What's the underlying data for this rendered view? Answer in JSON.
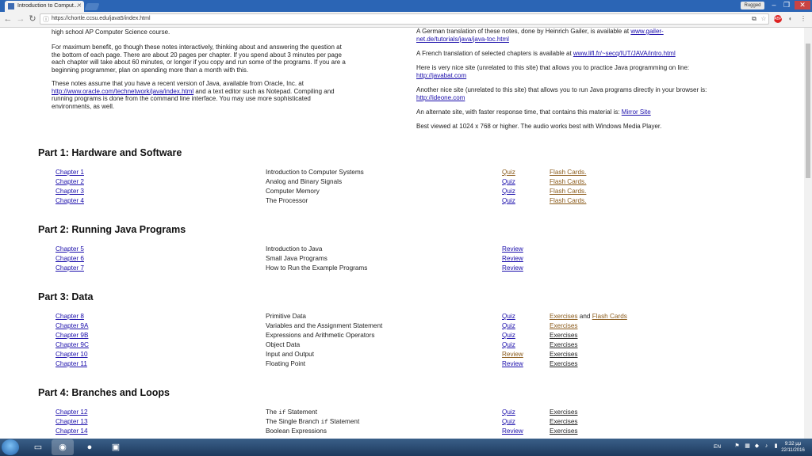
{
  "browser": {
    "tab_title": "Introduction to Comput...",
    "user_label": "Rugged",
    "url": "https://chortle.ccsu.edu/java5/index.html"
  },
  "intro_left": {
    "p0": "high school AP Computer Science course.",
    "p1": "For maximum benefit, go though these notes interactively, thinking about and answering the question at the bottom of each page. There are about 20 pages per chapter. If you spend about 3 minutes per page each chapter will take about 60 minutes, or longer if you copy and run some of the programs. If you are a beginning programmer, plan on spending more than a month with this.",
    "p2_a": "These notes assume that you have a recent version of Java, available from Oracle, Inc. at ",
    "p2_link": "http://www.oracle.com/technetwork/java/index.html",
    "p2_b": " and a text editor such as Notepad. Compiling and running programs is done from the command line interface. You may use more sophisticated environments, as well."
  },
  "intro_right": {
    "german_a": "A German translation of these notes, done by Heinrich Gailer, is available at ",
    "german_link": "www.gailer-net.de/tutorials/java/java-toc.html",
    "french_a": "A French translation of selected chapters is available at ",
    "french_link": "www.lifl.fr/~secq/IUT/JAVA/intro.html",
    "javabat_a": "Here is very nice site (unrelated to this site) that allows you to practice Java programming on line: ",
    "javabat_link": "http://javabat.com",
    "ideone_a": "Another nice site (unrelated to this site) that allows you to run Java programs directly in your browser is: ",
    "ideone_link": "http://ideone.com",
    "mirror_a": "An alternate site, with faster response time, that contains this material is: ",
    "mirror_link": "Mirror Site",
    "best_viewed": "Best viewed at 1024 x 768 or higher. The audio works best with Windows Media Player."
  },
  "parts": [
    {
      "title": "Part 1: Hardware and Software",
      "rows": [
        {
          "chapter": "Chapter 1",
          "topic": "Introduction to Computer Systems",
          "c3": "Quiz",
          "c4": "Flash Cards."
        },
        {
          "chapter": "Chapter 2",
          "topic": "Analog and Binary Signals",
          "c3": "Quiz",
          "c4": "Flash Cards."
        },
        {
          "chapter": "Chapter 3",
          "topic": "Computer Memory",
          "c3": "Quiz",
          "c4": "Flash Cards."
        },
        {
          "chapter": "Chapter 4",
          "topic": "The Processor",
          "c3": "Quiz",
          "c4": "Flash Cards."
        }
      ]
    },
    {
      "title": "Part 2: Running Java Programs",
      "rows": [
        {
          "chapter": "Chapter 5",
          "topic": "Introduction to Java",
          "c3": "Review"
        },
        {
          "chapter": "Chapter 6",
          "topic": "Small Java Programs",
          "c3": "Review"
        },
        {
          "chapter": "Chapter 7",
          "topic": "How to Run the Example Programs",
          "c3": "Review"
        }
      ]
    },
    {
      "title": "Part 3: Data",
      "rows": [
        {
          "chapter": "Chapter 8",
          "topic": "Primitive Data",
          "c3": "Quiz",
          "c4": "Exercises",
          "c4_and": " and ",
          "c4_extra": "Flash Cards"
        },
        {
          "chapter": "Chapter 9A",
          "topic": "Variables and the Assignment Statement",
          "c3": "Quiz",
          "c4": "Exercises"
        },
        {
          "chapter": "Chapter 9B",
          "topic": "Expressions and Arithmetic Operators",
          "c3": "Quiz",
          "c4": "Exercises"
        },
        {
          "chapter": "Chapter 9C",
          "topic": "Object Data",
          "c3": "Quiz",
          "c4": "Exercises"
        },
        {
          "chapter": "Chapter 10",
          "topic": "Input and Output",
          "c3": "Review",
          "c4": "Exercises"
        },
        {
          "chapter": "Chapter 11",
          "topic": "Floating Point",
          "c3": "Review",
          "c4": "Exercises"
        }
      ]
    },
    {
      "title": "Part 4: Branches and Loops",
      "rows": [
        {
          "chapter": "Chapter 12",
          "topic_pre": "The ",
          "topic_code": "if",
          "topic_post": " Statement",
          "c3": "Quiz",
          "c4": "Exercises"
        },
        {
          "chapter": "Chapter 13",
          "topic_pre": "The Single Branch ",
          "topic_code": "if",
          "topic_post": " Statement",
          "c3": "Quiz",
          "c4": "Exercises"
        },
        {
          "chapter": "Chapter 14",
          "topic": "Boolean Expressions",
          "c3": "Review",
          "c4": "Exercises"
        }
      ]
    }
  ],
  "taskbar": {
    "lang": "EN",
    "time": "9:32 μμ",
    "date": "22/11/2016"
  },
  "icons": {
    "back": "back-arrow-icon",
    "forward": "forward-arrow-icon",
    "reload": "reload-icon",
    "star": "bookmark-star-icon",
    "menu": "menu-icon"
  }
}
